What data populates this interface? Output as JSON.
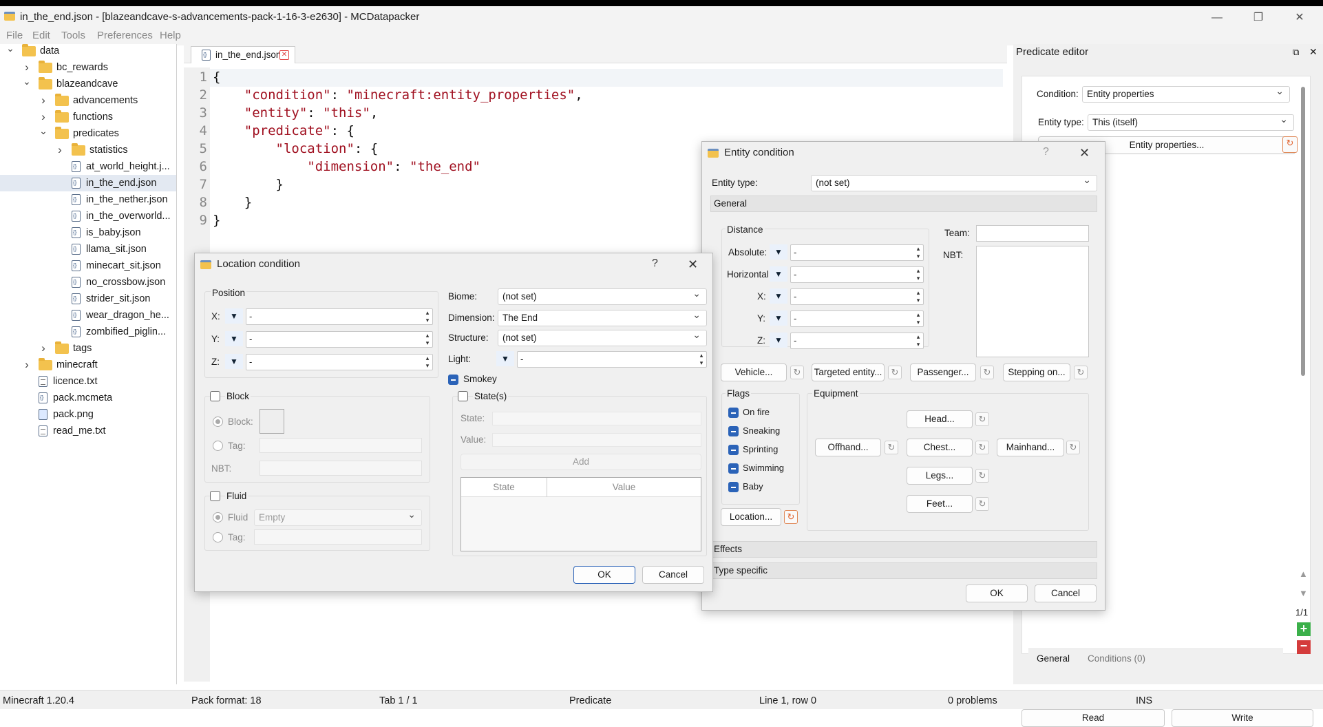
{
  "window": {
    "title": "in_the_end.json - [blazeandcave-s-advancements-pack-1-16-3-e2630] - MCDatapacker",
    "minimize": "—",
    "maximize": "❐",
    "close": "✕"
  },
  "menu": [
    "File",
    "Edit",
    "Tools",
    "Preferences",
    "Help"
  ],
  "tree": [
    {
      "label": "data",
      "type": "folder",
      "depth": 0,
      "exp": "open"
    },
    {
      "label": "bc_rewards",
      "type": "folder",
      "depth": 1,
      "exp": "closed"
    },
    {
      "label": "blazeandcave",
      "type": "folder",
      "depth": 1,
      "exp": "open"
    },
    {
      "label": "advancements",
      "type": "folder",
      "depth": 2,
      "exp": "closed"
    },
    {
      "label": "functions",
      "type": "folder",
      "depth": 2,
      "exp": "closed"
    },
    {
      "label": "predicates",
      "type": "folder",
      "depth": 2,
      "exp": "open"
    },
    {
      "label": "statistics",
      "type": "folder",
      "depth": 3,
      "exp": "closed"
    },
    {
      "label": "at_world_height.j...",
      "type": "json",
      "depth": 3
    },
    {
      "label": "in_the_end.json",
      "type": "json",
      "depth": 3,
      "selected": true
    },
    {
      "label": "in_the_nether.json",
      "type": "json",
      "depth": 3
    },
    {
      "label": "in_the_overworld...",
      "type": "json",
      "depth": 3
    },
    {
      "label": "is_baby.json",
      "type": "json",
      "depth": 3
    },
    {
      "label": "llama_sit.json",
      "type": "json",
      "depth": 3
    },
    {
      "label": "minecart_sit.json",
      "type": "json",
      "depth": 3
    },
    {
      "label": "no_crossbow.json",
      "type": "json",
      "depth": 3
    },
    {
      "label": "strider_sit.json",
      "type": "json",
      "depth": 3
    },
    {
      "label": "wear_dragon_he...",
      "type": "json",
      "depth": 3
    },
    {
      "label": "zombified_piglin...",
      "type": "json",
      "depth": 3
    },
    {
      "label": "tags",
      "type": "folder",
      "depth": 2,
      "exp": "closed"
    },
    {
      "label": "minecraft",
      "type": "folder",
      "depth": 1,
      "exp": "closed"
    },
    {
      "label": "licence.txt",
      "type": "txt",
      "depth": 1
    },
    {
      "label": "pack.mcmeta",
      "type": "json",
      "depth": 1
    },
    {
      "label": "pack.png",
      "type": "png",
      "depth": 1
    },
    {
      "label": "read_me.txt",
      "type": "txt",
      "depth": 1
    }
  ],
  "editor": {
    "tab_label": "in_the_end.json",
    "tab_close": "✕",
    "line_numbers": [
      "1",
      "2",
      "3",
      "4",
      "5",
      "6",
      "7",
      "8",
      "9"
    ],
    "lines": [
      [
        {
          "t": "{"
        }
      ],
      [
        {
          "t": "    "
        },
        {
          "t": "\"condition\"",
          "s": 1
        },
        {
          "t": ": "
        },
        {
          "t": "\"minecraft:entity_properties\"",
          "s": 1
        },
        {
          "t": ","
        }
      ],
      [
        {
          "t": "    "
        },
        {
          "t": "\"entity\"",
          "s": 1
        },
        {
          "t": ": "
        },
        {
          "t": "\"this\"",
          "s": 1
        },
        {
          "t": ","
        }
      ],
      [
        {
          "t": "    "
        },
        {
          "t": "\"predicate\"",
          "s": 1
        },
        {
          "t": ": {"
        }
      ],
      [
        {
          "t": "        "
        },
        {
          "t": "\"location\"",
          "s": 1
        },
        {
          "t": ": {"
        }
      ],
      [
        {
          "t": "            "
        },
        {
          "t": "\"dimension\"",
          "s": 1
        },
        {
          "t": ": "
        },
        {
          "t": "\"the_end\"",
          "s": 1
        }
      ],
      [
        {
          "t": "        }"
        }
      ],
      [
        {
          "t": "    }"
        }
      ],
      [
        {
          "t": "}"
        }
      ]
    ]
  },
  "predicate_editor": {
    "header": "Predicate editor",
    "float": "⧉",
    "close": "✕",
    "condition_label": "Condition:",
    "condition_value": "Entity properties",
    "entity_type_label": "Entity type:",
    "entity_type_value": "This (itself)",
    "entity_props_button": "Entity properties...",
    "counter": "1/1",
    "tabs": [
      "General",
      "Conditions (0)"
    ],
    "read": "Read",
    "write": "Write",
    "scroll_up": "▲",
    "scroll_down": "▼",
    "add": "+",
    "remove": "−"
  },
  "entity_dialog": {
    "title": "Entity condition",
    "help": "?",
    "close": "✕",
    "entity_type_label": "Entity type:",
    "entity_type_value": "(not set)",
    "general": "General",
    "distance": "Distance",
    "absolute": "Absolute:",
    "horizontal": "Horizontal",
    "x": "X:",
    "y": "Y:",
    "z": "Z:",
    "dash": "-",
    "team": "Team:",
    "nbt": "NBT:",
    "vehicle": "Vehicle...",
    "targeted": "Targeted entity...",
    "passenger": "Passenger...",
    "stepping": "Stepping on...",
    "flags": "Flags",
    "flag_items": [
      "On fire",
      "Sneaking",
      "Sprinting",
      "Swimming",
      "Baby"
    ],
    "equipment": "Equipment",
    "head": "Head...",
    "offhand": "Offhand...",
    "chest": "Chest...",
    "mainhand": "Mainhand...",
    "legs": "Legs...",
    "feet": "Feet...",
    "location": "Location...",
    "effects": "Effects",
    "type_specific": "Type specific",
    "ok": "OK",
    "cancel": "Cancel"
  },
  "location_dialog": {
    "title": "Location condition",
    "help": "?",
    "close": "✕",
    "position": "Position",
    "x": "X:",
    "y": "Y:",
    "z": "Z:",
    "dash": "-",
    "biome_label": "Biome:",
    "biome_value": "(not set)",
    "dimension_label": "Dimension:",
    "dimension_value": "The End",
    "structure_label": "Structure:",
    "structure_value": "(not set)",
    "light_label": "Light:",
    "smokey": "Smokey",
    "block": "Block",
    "block_radio": "Block:",
    "tag": "Tag:",
    "nbt": "NBT:",
    "states": "State(s)",
    "state": "State:",
    "value": "Value:",
    "add": "Add",
    "col_state": "State",
    "col_value": "Value",
    "fluid": "Fluid",
    "fluid_radio": "Fluid",
    "fluid_value": "Empty",
    "fluid_tag": "Tag:",
    "ok": "OK",
    "cancel": "Cancel"
  },
  "status": [
    "Minecraft 1.20.4",
    "Pack format: 18",
    "Tab 1 / 1",
    "Predicate",
    "Line 1, row 0",
    "0 problems",
    "INS"
  ]
}
